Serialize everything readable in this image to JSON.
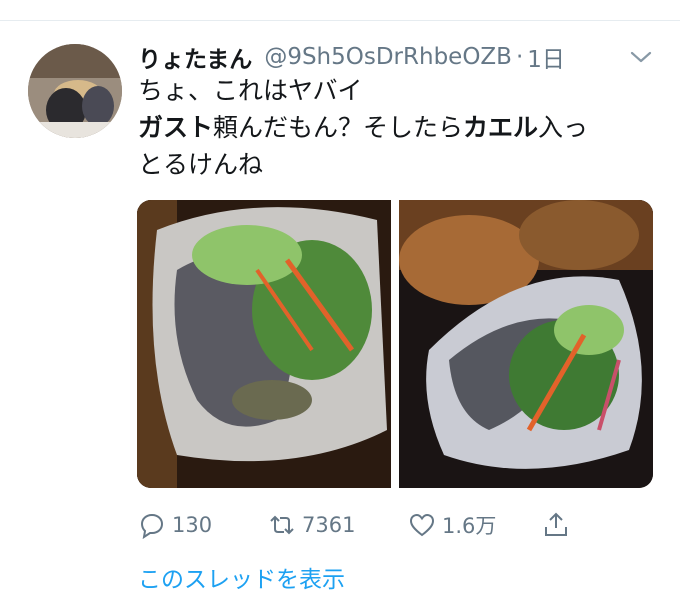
{
  "tweet": {
    "display_name": "りょたまん",
    "handle": "@9Sh5OsDrRhbeOZB",
    "separator": "·",
    "time": "1日",
    "line1": "ちょ、これはヤバイ",
    "line2_a": "ガスト",
    "line2_b": "頼んだもん？そしたら",
    "line2_c": "カエル",
    "line2_d": "入っ",
    "line3": "とるけんね"
  },
  "actions": {
    "reply_count": "130",
    "retweet_count": "7361",
    "like_count": "1.6万"
  },
  "thread_link": "このスレッドを表示",
  "icons": {
    "more": "chevron-down-icon",
    "reply": "reply-icon",
    "retweet": "retweet-icon",
    "like": "heart-icon",
    "share": "share-icon"
  },
  "colors": {
    "accent": "#1da1f2",
    "muted": "#657786",
    "text": "#14171a"
  }
}
